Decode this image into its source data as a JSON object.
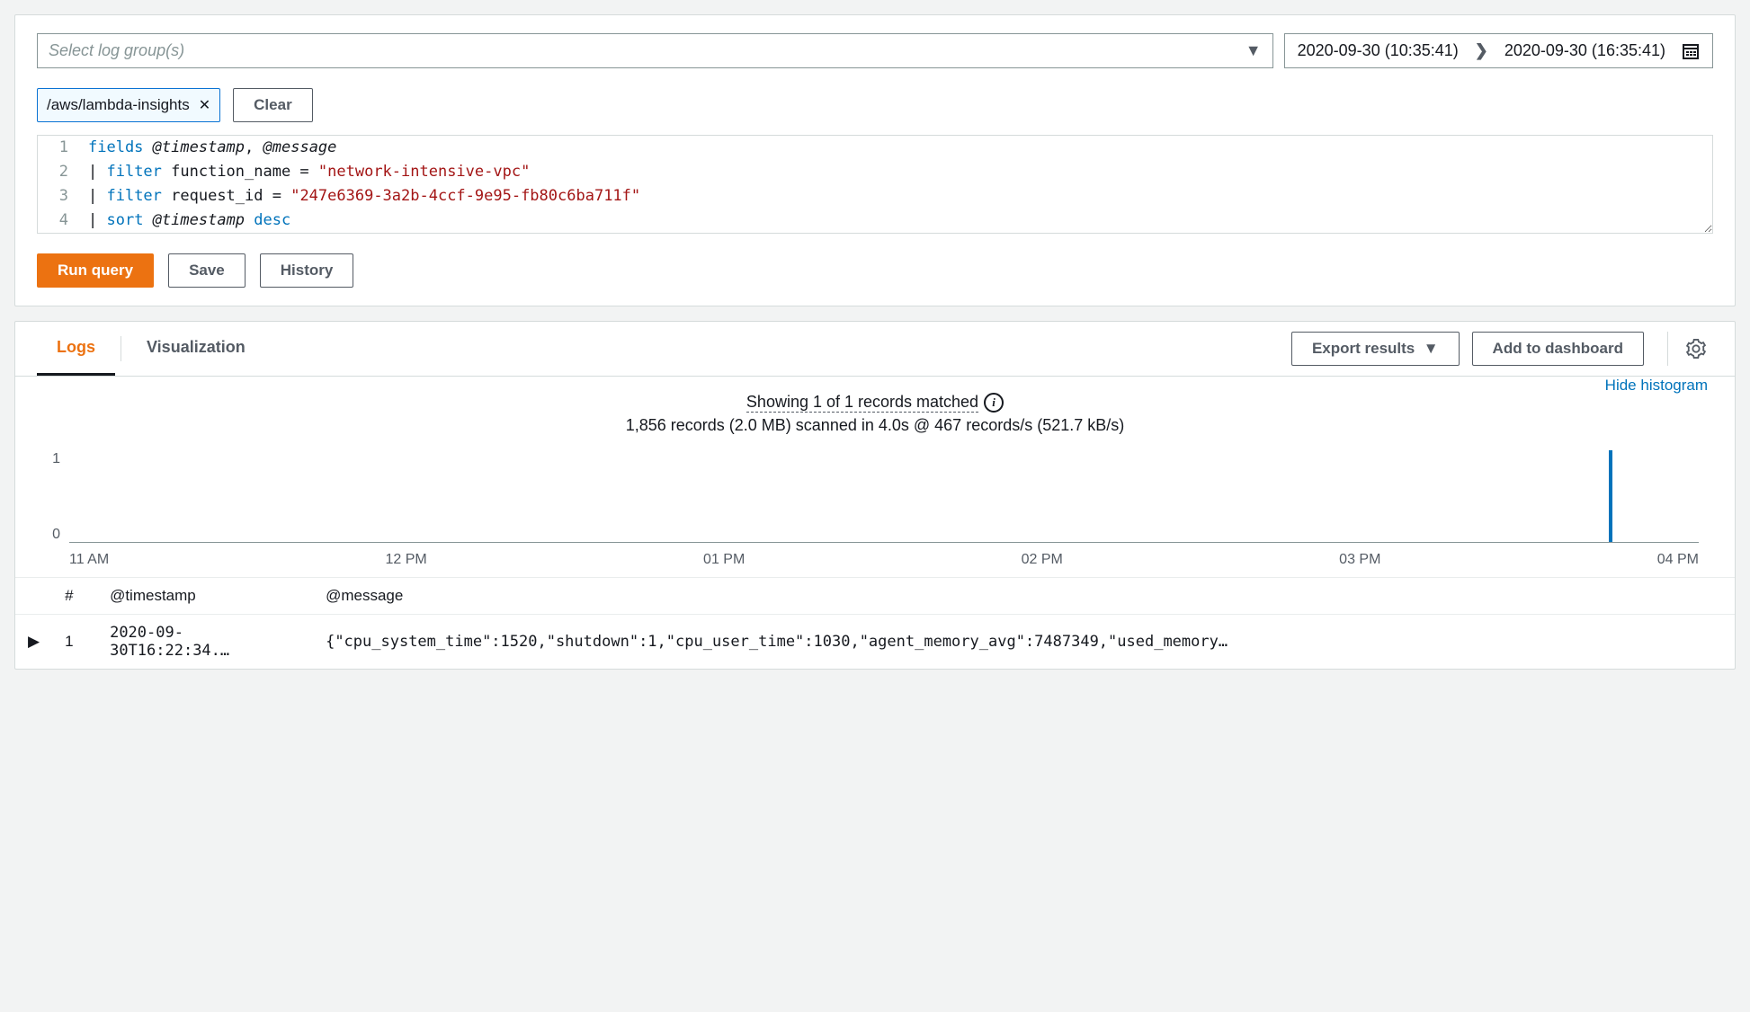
{
  "query": {
    "log_group_placeholder": "Select log group(s)",
    "date_from": "2020-09-30 (10:35:41)",
    "date_to": "2020-09-30 (16:35:41)",
    "selected_group": "/aws/lambda-insights",
    "clear_label": "Clear",
    "lines": [
      {
        "n": "1",
        "parts": [
          [
            "kw",
            "fields"
          ],
          [
            "sp",
            " "
          ],
          [
            "italic",
            "@timestamp"
          ],
          [
            "plain",
            ", "
          ],
          [
            "italic",
            "@message"
          ]
        ]
      },
      {
        "n": "2",
        "parts": [
          [
            "plain",
            "| "
          ],
          [
            "kw",
            "filter"
          ],
          [
            "plain",
            " function_name = "
          ],
          [
            "str",
            "\"network-intensive-vpc\""
          ]
        ]
      },
      {
        "n": "3",
        "parts": [
          [
            "plain",
            "| "
          ],
          [
            "kw",
            "filter"
          ],
          [
            "plain",
            " request_id = "
          ],
          [
            "str",
            "\"247e6369-3a2b-4ccf-9e95-fb80c6ba711f\""
          ]
        ]
      },
      {
        "n": "4",
        "parts": [
          [
            "plain",
            "| "
          ],
          [
            "kw",
            "sort"
          ],
          [
            "sp",
            " "
          ],
          [
            "italic",
            "@timestamp"
          ],
          [
            "sp",
            " "
          ],
          [
            "kw",
            "desc"
          ]
        ]
      }
    ],
    "run_label": "Run query",
    "save_label": "Save",
    "history_label": "History"
  },
  "results": {
    "tabs": {
      "logs": "Logs",
      "visualization": "Visualization"
    },
    "export_label": "Export results",
    "dashboard_label": "Add to dashboard",
    "summary_main": "Showing 1 of 1 records matched",
    "summary_sub": "1,856 records (2.0 MB) scanned in 4.0s @ 467 records/s (521.7 kB/s)",
    "hide_histogram": "Hide histogram",
    "chart_data": {
      "type": "bar",
      "ylim": [
        0,
        1
      ],
      "yticks": [
        "1",
        "0"
      ],
      "categories": [
        "11 AM",
        "12 PM",
        "01 PM",
        "02 PM",
        "03 PM",
        "04 PM"
      ],
      "value_position_pct": 94.5,
      "value": 1
    },
    "table": {
      "headers": {
        "num": "#",
        "ts": "@timestamp",
        "msg": "@message"
      },
      "rows": [
        {
          "n": "1",
          "ts": "2020-09-30T16:22:34.…",
          "msg": "{\"cpu_system_time\":1520,\"shutdown\":1,\"cpu_user_time\":1030,\"agent_memory_avg\":7487349,\"used_memory…"
        }
      ]
    }
  }
}
